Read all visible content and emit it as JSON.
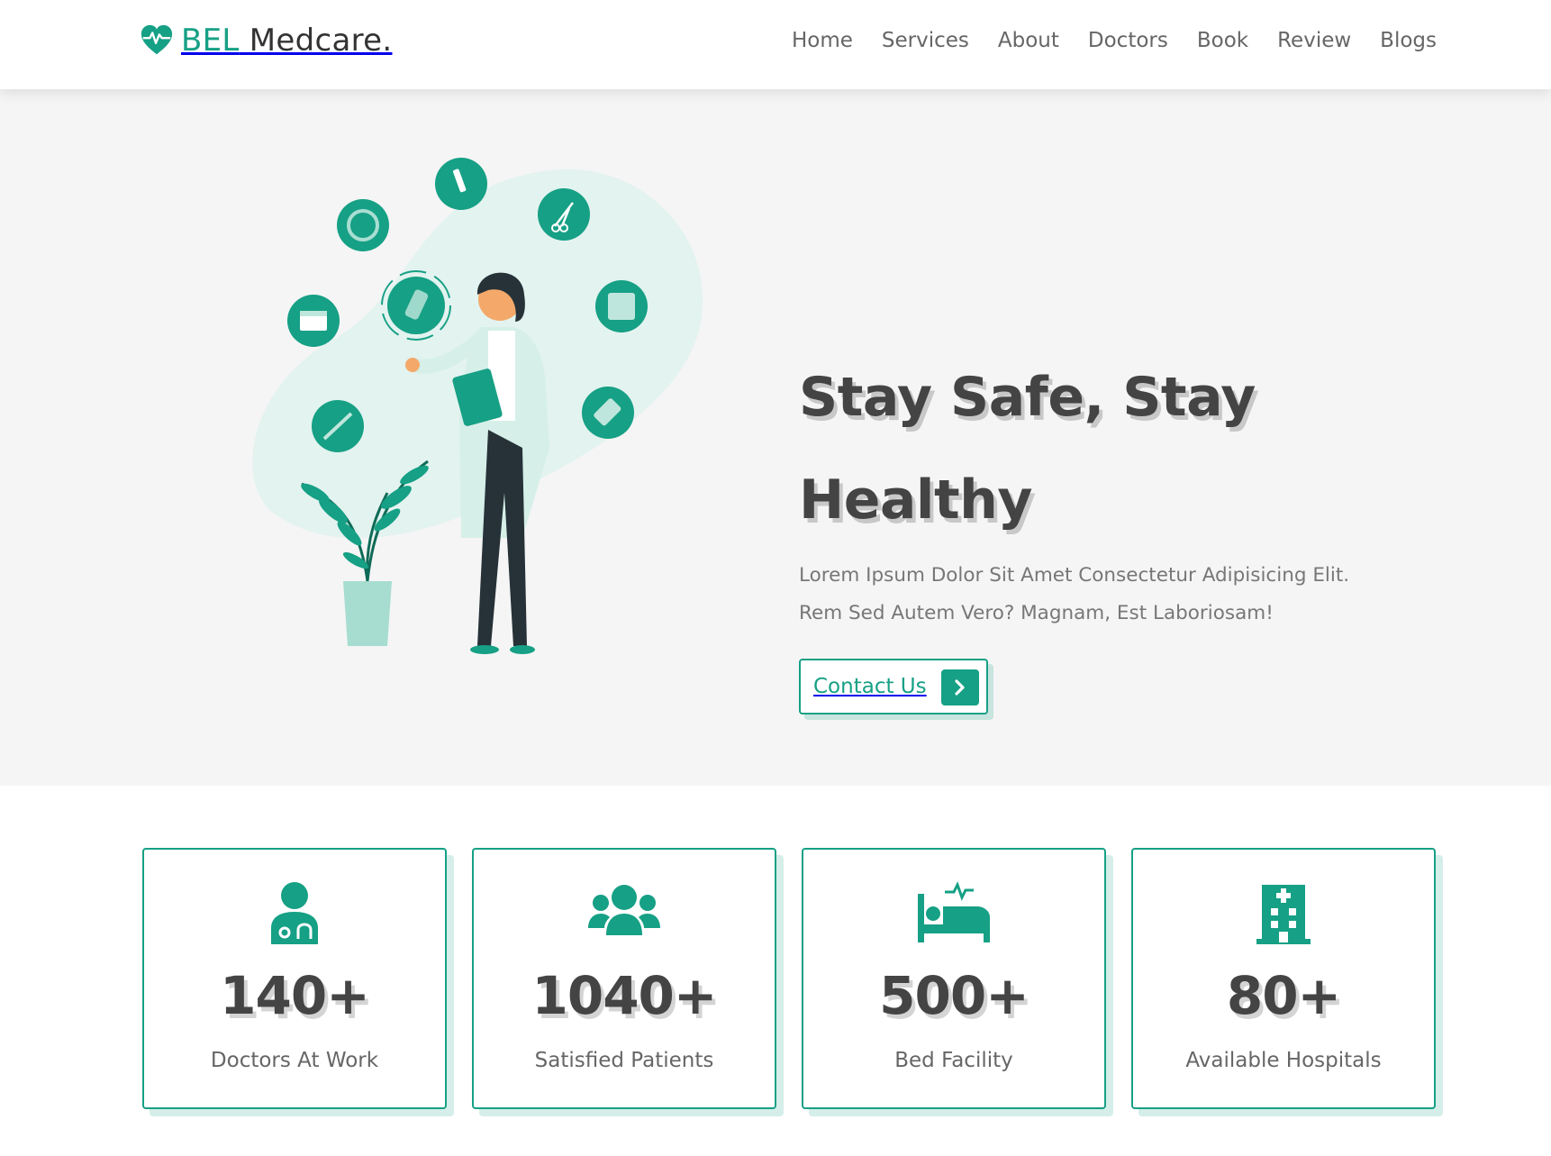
{
  "brand": {
    "name_accent": "BEL",
    "name_rest": " Medcare.",
    "logo_icon": "heart-pulse-icon"
  },
  "nav": {
    "items": [
      "Home",
      "Services",
      "About",
      "Doctors",
      "Book",
      "Review",
      "Blogs"
    ]
  },
  "hero": {
    "title_line1": "Stay Safe, Stay",
    "title_line2": "Healthy",
    "desc_line1": "Lorem Ipsum Dolor Sit Amet Consectetur Adipisicing Elit.",
    "desc_line2": "Rem Sed Autem Vero? Magnam, Est Laboriosam!",
    "cta_label": "Contact Us",
    "cta_icon": "chevron-right-icon"
  },
  "stats": [
    {
      "icon": "doctor-icon",
      "number": "140+",
      "label": "Doctors At Work"
    },
    {
      "icon": "users-icon",
      "number": "1040+",
      "label": "Satisfied Patients"
    },
    {
      "icon": "bed-icon",
      "number": "500+",
      "label": "Bed Facility"
    },
    {
      "icon": "hospital-icon",
      "number": "80+",
      "label": "Available Hospitals"
    }
  ],
  "colors": {
    "accent": "#16a085",
    "hero_bg": "#f5f5f5",
    "text_dark": "#444444",
    "text_muted": "#777777"
  }
}
